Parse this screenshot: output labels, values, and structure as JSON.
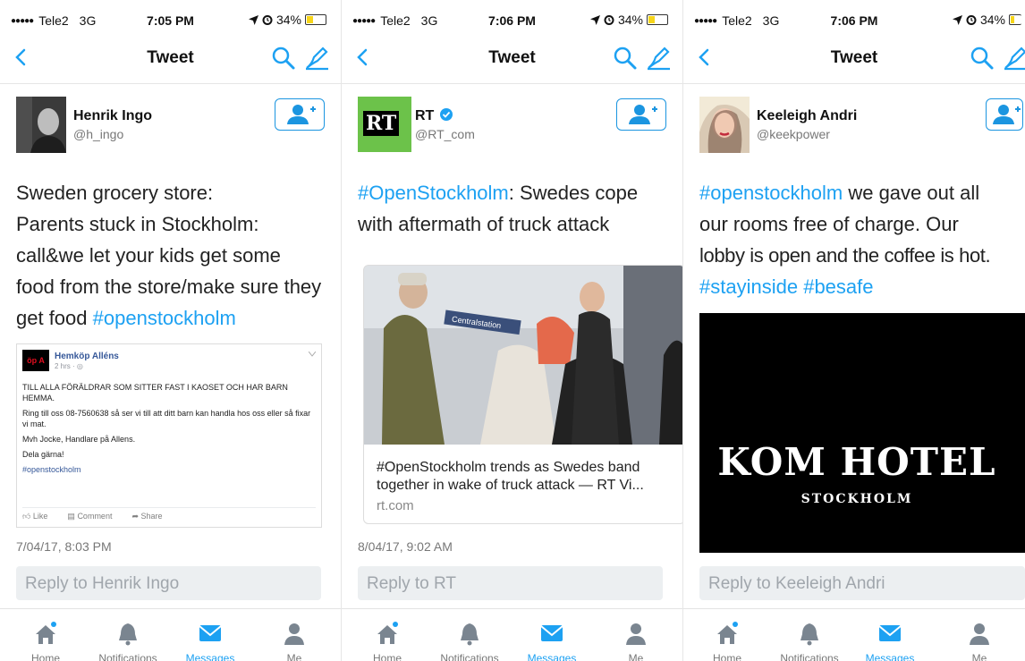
{
  "colors": {
    "accent": "#1da1f2",
    "icon_gray": "#7a8590",
    "battery": "#f7d51a"
  },
  "panels": [
    {
      "status": {
        "carrier": "Tele2",
        "network": "3G",
        "time": "7:05 PM",
        "battery": "34%",
        "battery_level": 0.34
      },
      "nav": {
        "title": "Tweet"
      },
      "author": {
        "name": "Henrik Ingo",
        "handle": "@h_ingo"
      },
      "tweet": {
        "line1": "Sweden grocery store:",
        "line2": "Parents stuck in Stockholm:",
        "line3": "call&we let your kids get some",
        "line4": "food from the store/make sure they",
        "line5_prefix": "get food ",
        "line5_hashtag": "#openstockholm"
      },
      "embed": {
        "logo": "öp A",
        "page_name": "Hemköp Alléns",
        "time": "2 hrs · ◎",
        "p1": "TILL ALLA FÖRÄLDRAR SOM SITTER FAST I KAOSET OCH HAR BARN HEMMA.",
        "p2": "Ring till oss 08-7560638 så ser vi till att ditt barn kan handla hos oss eller så fixar vi mat.",
        "p3": "Mvh Jocke, Handlare på Allens.",
        "p4": "Dela gärna!",
        "p5": "#openstockholm",
        "like": "Like",
        "comment": "Comment",
        "share": "Share"
      },
      "date": "7/04/17, 8:03 PM",
      "reply_placeholder": "Reply to Henrik Ingo"
    },
    {
      "status": {
        "carrier": "Tele2",
        "network": "3G",
        "time": "7:06 PM",
        "battery": "34%",
        "battery_level": 0.34
      },
      "nav": {
        "title": "Tweet"
      },
      "author": {
        "name": "RT",
        "handle": "@RT_com",
        "logo": "RT"
      },
      "tweet": {
        "line1_hashtag": "#OpenStockholm",
        "line1_rest": ": Swedes cope",
        "line2": "with aftermath of truck attack"
      },
      "link_card": {
        "street_sign": "Centralstation",
        "title": "#OpenStockholm trends as Swedes band together in wake of truck attack — RT Vi...",
        "domain": "rt.com"
      },
      "date": "8/04/17, 9:02 AM",
      "reply_placeholder": "Reply to RT"
    },
    {
      "status": {
        "carrier": "Tele2",
        "network": "3G",
        "time": "7:06 PM",
        "battery": "34%",
        "battery_level": 0.34
      },
      "nav": {
        "title": "Tweet"
      },
      "author": {
        "name": "Keeleigh Andri",
        "handle": "@keekpower"
      },
      "tweet": {
        "line1_hashtag": "#openstockholm",
        "line1_rest": " we gave out all",
        "line2": "our rooms free of charge. Our",
        "line3": "lobby is open and the coffee is hot.",
        "line4_hashtag1": "#stayinside",
        "line4_hashtag2": "#besafe"
      },
      "image": {
        "title": "KOM HOTEL",
        "subtitle": "STOCKHOLM"
      },
      "reply_placeholder": "Reply to Keeleigh Andri"
    }
  ],
  "tabs": {
    "home": "Home",
    "notifications": "Notifications",
    "messages": "Messages",
    "me": "Me"
  }
}
